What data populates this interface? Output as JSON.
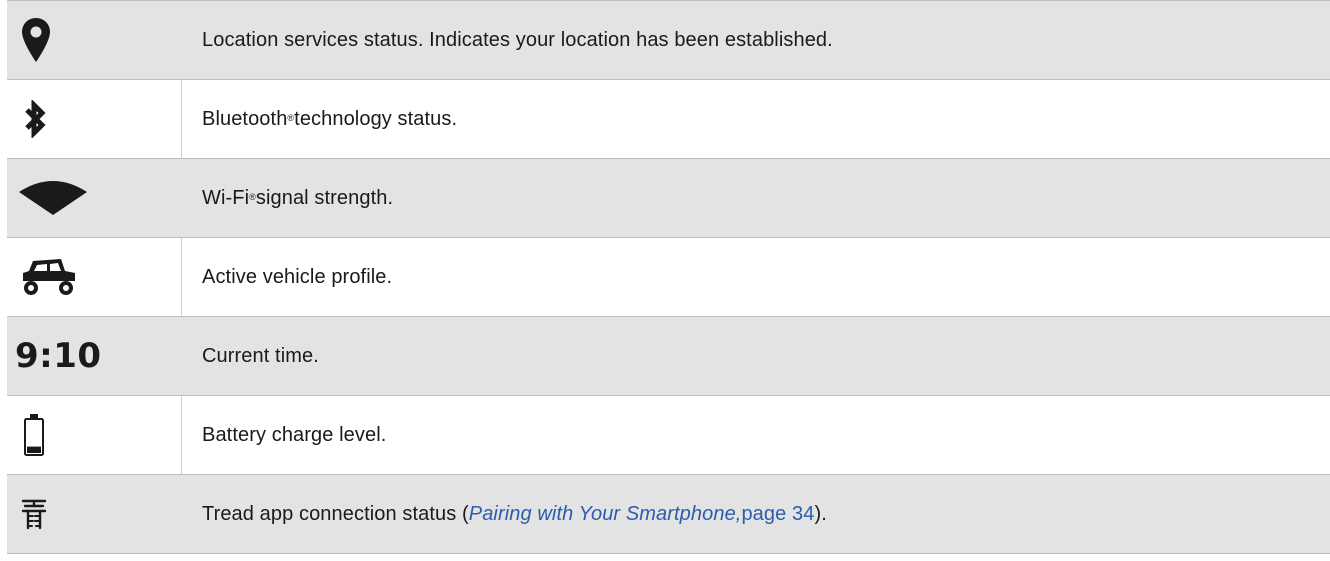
{
  "rows": [
    {
      "icon": "location-pin-icon",
      "description": "Location services status. Indicates your location has been established."
    },
    {
      "icon": "bluetooth-icon",
      "description_main": "Bluetooth",
      "description_mark": "®",
      "description_rest": " technology status."
    },
    {
      "icon": "wifi-signal-icon",
      "description_main": "Wi-Fi",
      "description_mark": "®",
      "description_rest": " signal strength."
    },
    {
      "icon": "vehicle-profile-icon",
      "description": "Active vehicle profile."
    },
    {
      "icon": "time-display",
      "time_text": "9:10",
      "description": "Current time."
    },
    {
      "icon": "battery-icon",
      "battery_level": 0.2,
      "description": "Battery charge level."
    },
    {
      "icon": "tread-app-icon",
      "description_prefix": "Tread app connection status (",
      "xref_text": "Pairing with Your Smartphone,",
      "page_text": " page 34",
      "description_suffix": ")."
    }
  ],
  "colors": {
    "shaded_row": "#e3e3e3",
    "link": "#2a5db0",
    "icon": "#1a1a1a"
  }
}
